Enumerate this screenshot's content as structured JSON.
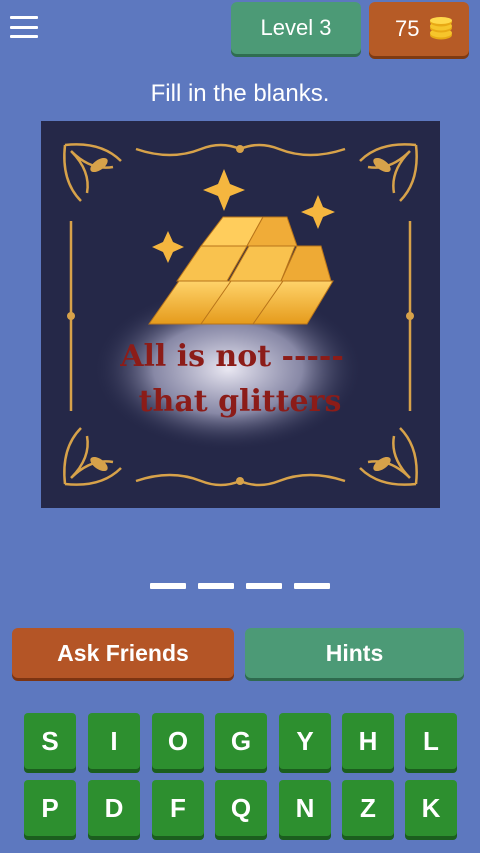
{
  "header": {
    "level_label": "Level 3",
    "coins": "75"
  },
  "prompt": "Fill in the blanks.",
  "puzzle": {
    "line1": "All is not -----",
    "line2": "that glitters"
  },
  "answer_blanks": 4,
  "actions": {
    "ask_friends": "Ask Friends",
    "hints": "Hints"
  },
  "keyboard": {
    "row1": [
      "S",
      "I",
      "O",
      "G",
      "Y",
      "H",
      "L"
    ],
    "row2": [
      "P",
      "D",
      "F",
      "Q",
      "N",
      "Z",
      "K"
    ]
  },
  "colors": {
    "background": "#5d78bf",
    "green_button": "#4c9a76",
    "orange_button": "#b65b26",
    "key_green": "#2d8f2f",
    "gold": "#e9b44c",
    "puzzle_text": "#8c1c18"
  }
}
